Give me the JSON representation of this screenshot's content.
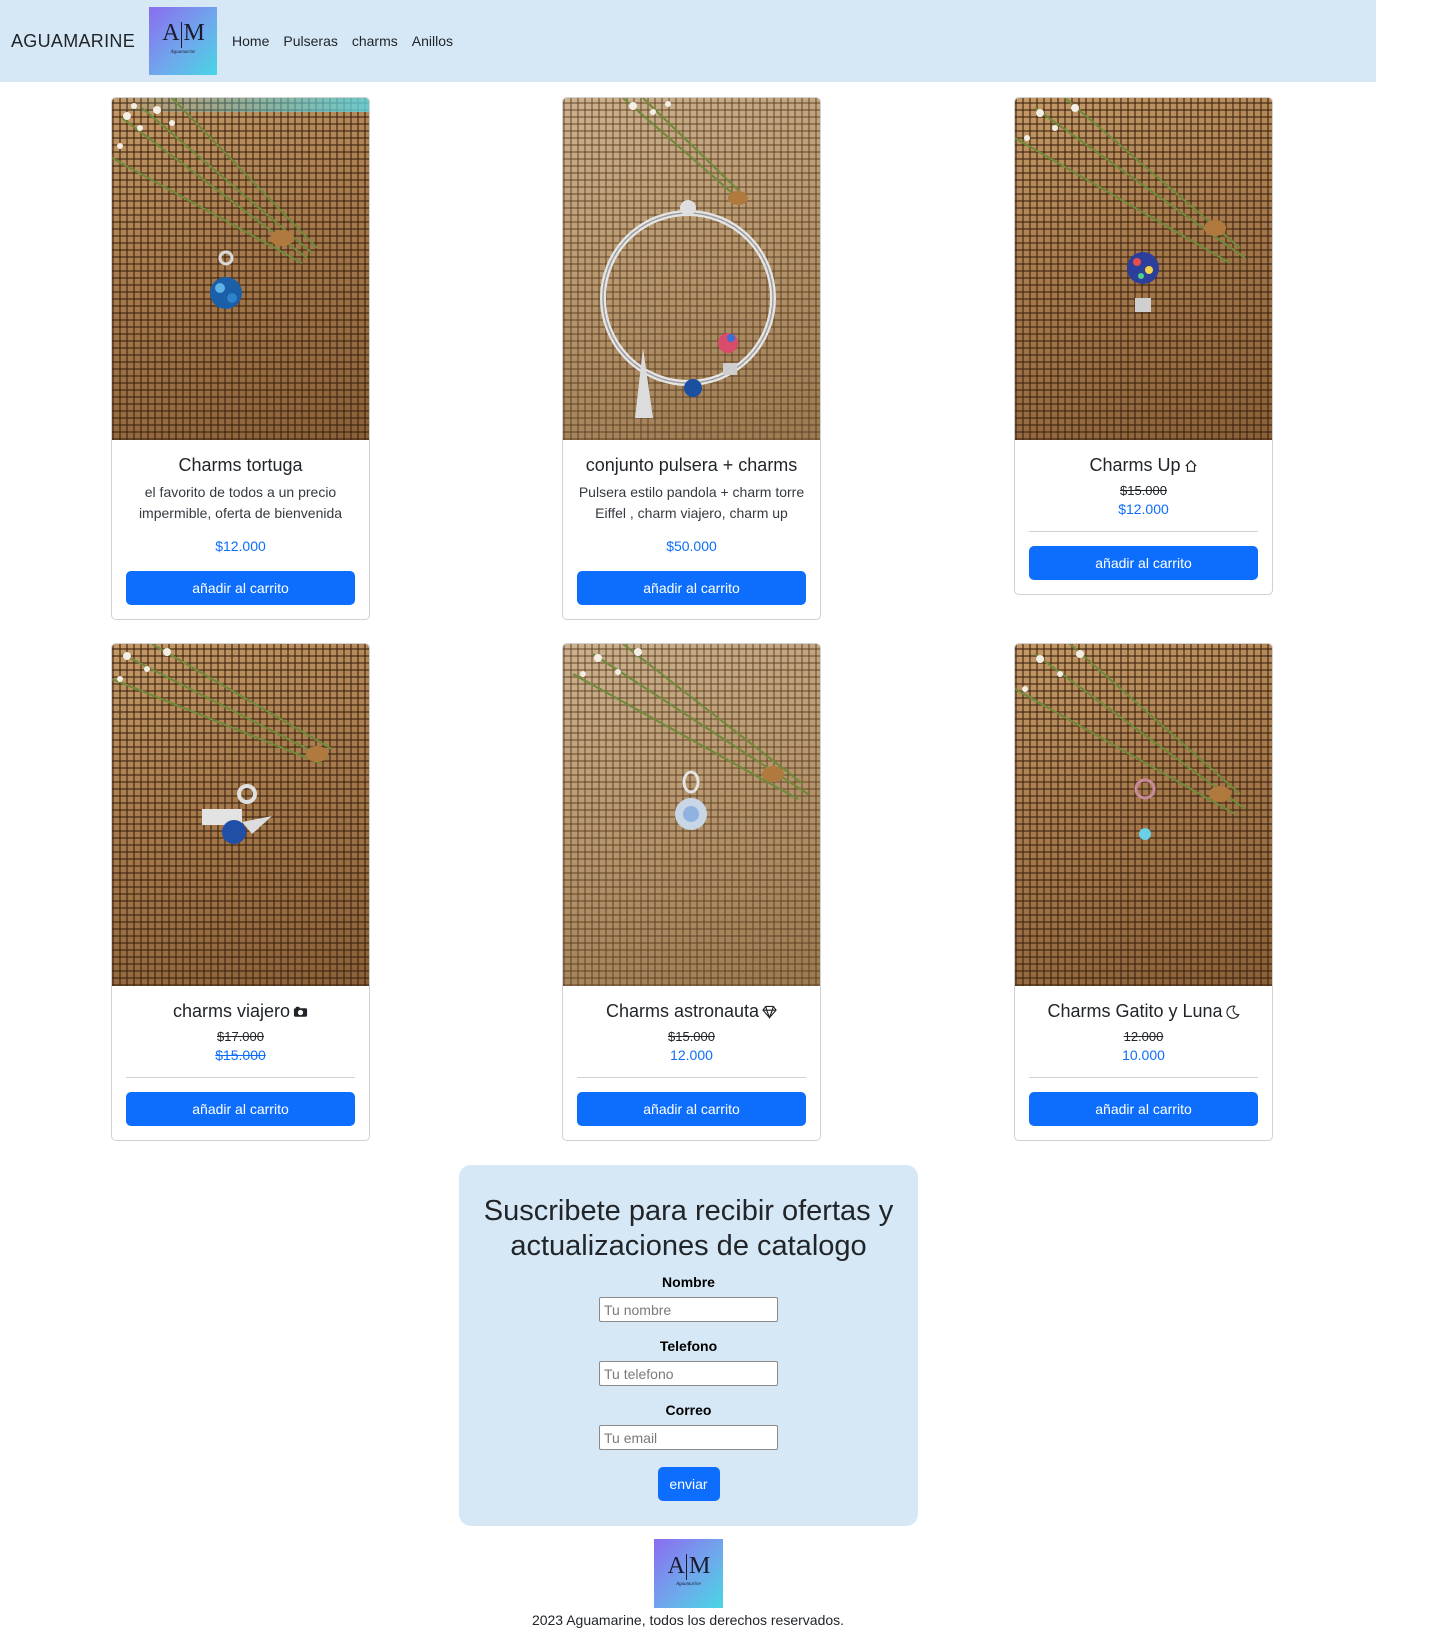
{
  "navbar": {
    "brand": "AGUAMARINE",
    "logo_text": "A|M",
    "logo_sub": "Aguamarine",
    "links": [
      "Home",
      "Pulseras",
      "charms",
      "Anillos"
    ]
  },
  "products": [
    {
      "title": "Charms tortuga",
      "icon": "",
      "description": "el favorito de todos a un precio impermible, oferta de bienvenida",
      "price": "$12.000",
      "button": "añadir al carrito"
    },
    {
      "title": "conjunto pulsera + charms",
      "icon": "",
      "description": "Pulsera estilo pandola + charm torre Eiffel , charm viajero, charm up",
      "price": "$50.000",
      "button": "añadir al carrito"
    },
    {
      "title": "Charms Up",
      "icon": "house-icon",
      "old_price": "$15.000",
      "new_price": "$12.000",
      "button": "añadir al carrito"
    },
    {
      "title": "charms viajero",
      "icon": "camera-icon",
      "old_price": "$17.000",
      "new_price": "$15.000",
      "new_price_struck": true,
      "button": "añadir al carrito"
    },
    {
      "title": "Charms astronauta",
      "icon": "gem-icon",
      "old_price": "$15.000",
      "new_price": "12.000",
      "button": "añadir al carrito"
    },
    {
      "title": "Charms Gatito y Luna",
      "icon": "moon-icon",
      "old_price": "12.000",
      "new_price": "10.000",
      "button": "añadir al carrito"
    }
  ],
  "subscribe": {
    "title": "Suscribete para recibir ofertas y actualizaciones de catalogo",
    "fields": [
      {
        "label": "Nombre",
        "placeholder": "Tu nombre"
      },
      {
        "label": "Telefono",
        "placeholder": "Tu telefono"
      },
      {
        "label": "Correo",
        "placeholder": "Tu email"
      }
    ],
    "button": "enviar"
  },
  "footer": {
    "logo_text": "A|M",
    "copyright": "2023 Aguamarine, todos los derechos reservados."
  },
  "colors": {
    "navbar_bg": "#d6e8f6",
    "accent": "#0d6efd"
  }
}
